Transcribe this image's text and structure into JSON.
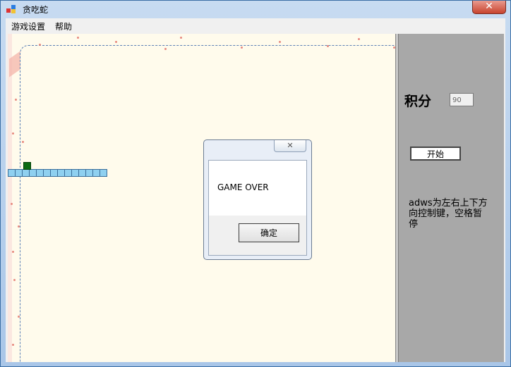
{
  "window": {
    "title": "贪吃蛇",
    "close_glyph": "✕"
  },
  "menu": {
    "items": [
      "游戏设置",
      "帮助"
    ]
  },
  "side": {
    "score_label": "积分",
    "score_value": "90",
    "start_label": "开始",
    "help_text": "adws为左右上下方向控制键，空格暂停"
  },
  "dialog": {
    "message": "GAME OVER",
    "ok_label": "确定",
    "close_glyph": "✕"
  },
  "snake": {
    "segments": 14,
    "food_color": "#0a6a12",
    "body_color": "#8fd0f0"
  },
  "colors": {
    "board_bg": "#fffbec",
    "side_bg": "#a8a8a8",
    "border_dash": "#5a7fb5"
  },
  "icons": {
    "app_icon": "snake-game-app-icon",
    "close_icon": "close-icon"
  }
}
